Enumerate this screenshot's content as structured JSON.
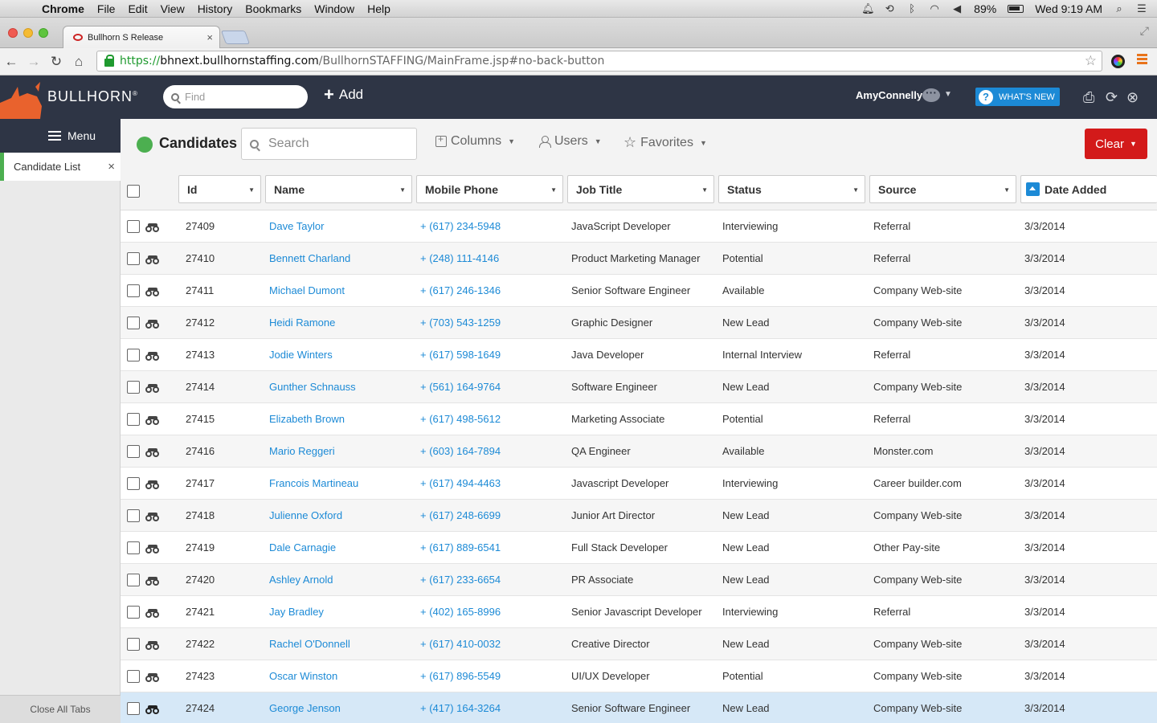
{
  "os_menu": {
    "app": "Chrome",
    "items": [
      "File",
      "Edit",
      "View",
      "History",
      "Bookmarks",
      "Window",
      "Help"
    ],
    "battery": "89%",
    "clock": "Wed 9:19 AM"
  },
  "browser": {
    "tab_title": "Bullhorn S Release",
    "url_scheme": "https://",
    "url_host": "bhnext.bullhornstaffing.com",
    "url_path": "/BullhornSTAFFING/MainFrame.jsp#no-back-button"
  },
  "app_header": {
    "brand": "BULLHORN",
    "find_placeholder": "Find",
    "add_label": "Add",
    "user_name": "AmyConnelly",
    "whats_new": "WHAT'S NEW"
  },
  "sidebar": {
    "menu_label": "Menu",
    "open_tab": "Candidate List",
    "close_all": "Close All Tabs"
  },
  "toolbar": {
    "entity_title": "Candidates",
    "search_placeholder": "Search",
    "columns_label": "Columns",
    "users_label": "Users",
    "favorites_label": "Favorites",
    "clear_label": "Clear"
  },
  "grid": {
    "columns": [
      "Id",
      "Name",
      "Mobile Phone",
      "Job Title",
      "Status",
      "Source",
      "Date Added"
    ],
    "sorted_column": "Date Added",
    "rows": [
      {
        "id": "27409",
        "name": "Dave Taylor",
        "phone": "+ (617) 234-5948",
        "job": "JavaScript Developer",
        "status": "Interviewing",
        "source": "Referral",
        "date": "3/3/2014"
      },
      {
        "id": "27410",
        "name": "Bennett Charland",
        "phone": "+ (248) 111-4146",
        "job": "Product Marketing Manager",
        "status": "Potential",
        "source": "Referral",
        "date": "3/3/2014"
      },
      {
        "id": "27411",
        "name": "Michael Dumont",
        "phone": "+ (617) 246-1346",
        "job": "Senior Software Engineer",
        "status": "Available",
        "source": "Company Web-site",
        "date": "3/3/2014"
      },
      {
        "id": "27412",
        "name": "Heidi Ramone",
        "phone": "+ (703) 543-1259",
        "job": "Graphic Designer",
        "status": "New Lead",
        "source": "Company Web-site",
        "date": "3/3/2014"
      },
      {
        "id": "27413",
        "name": "Jodie Winters",
        "phone": "+ (617) 598-1649",
        "job": "Java Developer",
        "status": "Internal Interview",
        "source": "Referral",
        "date": "3/3/2014"
      },
      {
        "id": "27414",
        "name": "Gunther Schnauss",
        "phone": "+ (561) 164-9764",
        "job": "Software Engineer",
        "status": "New Lead",
        "source": "Company Web-site",
        "date": "3/3/2014"
      },
      {
        "id": "27415",
        "name": "Elizabeth Brown",
        "phone": "+ (617) 498-5612",
        "job": "Marketing Associate",
        "status": "Potential",
        "source": "Referral",
        "date": "3/3/2014"
      },
      {
        "id": "27416",
        "name": "Mario Reggeri",
        "phone": "+ (603) 164-7894",
        "job": "QA Engineer",
        "status": "Available",
        "source": "Monster.com",
        "date": "3/3/2014"
      },
      {
        "id": "27417",
        "name": "Francois Martineau",
        "phone": "+ (617) 494-4463",
        "job": "Javascript Developer",
        "status": "Interviewing",
        "source": "Career builder.com",
        "date": "3/3/2014"
      },
      {
        "id": "27418",
        "name": "Julienne Oxford",
        "phone": "+ (617) 248-6699",
        "job": "Junior Art Director",
        "status": "New Lead",
        "source": "Company Web-site",
        "date": "3/3/2014"
      },
      {
        "id": "27419",
        "name": "Dale Carnagie",
        "phone": "+ (617) 889-6541",
        "job": "Full Stack Developer",
        "status": "New Lead",
        "source": "Other Pay-site",
        "date": "3/3/2014"
      },
      {
        "id": "27420",
        "name": "Ashley Arnold",
        "phone": "+ (617) 233-6654",
        "job": "PR Associate",
        "status": "New Lead",
        "source": "Company Web-site",
        "date": "3/3/2014"
      },
      {
        "id": "27421",
        "name": "Jay Bradley",
        "phone": "+ (402) 165-8996",
        "job": "Senior Javascript Developer",
        "status": "Interviewing",
        "source": "Referral",
        "date": "3/3/2014"
      },
      {
        "id": "27422",
        "name": "Rachel O'Donnell",
        "phone": "+ (617) 410-0032",
        "job": "Creative Director",
        "status": "New Lead",
        "source": "Company Web-site",
        "date": "3/3/2014"
      },
      {
        "id": "27423",
        "name": "Oscar Winston",
        "phone": "+ (617) 896-5549",
        "job": "UI/UX Developer",
        "status": "Potential",
        "source": "Company Web-site",
        "date": "3/3/2014"
      },
      {
        "id": "27424",
        "name": "George Jenson",
        "phone": "+ (417) 164-3264",
        "job": "Senior Software Engineer",
        "status": "New Lead",
        "source": "Company Web-site",
        "date": "3/3/2014"
      }
    ],
    "highlighted_row": 15
  },
  "colors": {
    "header_bg": "#2e3545",
    "link": "#1c8ad6",
    "clear_button": "#d31a1a",
    "status_green": "#4caf50",
    "selected_row": "#d6e8f7"
  }
}
